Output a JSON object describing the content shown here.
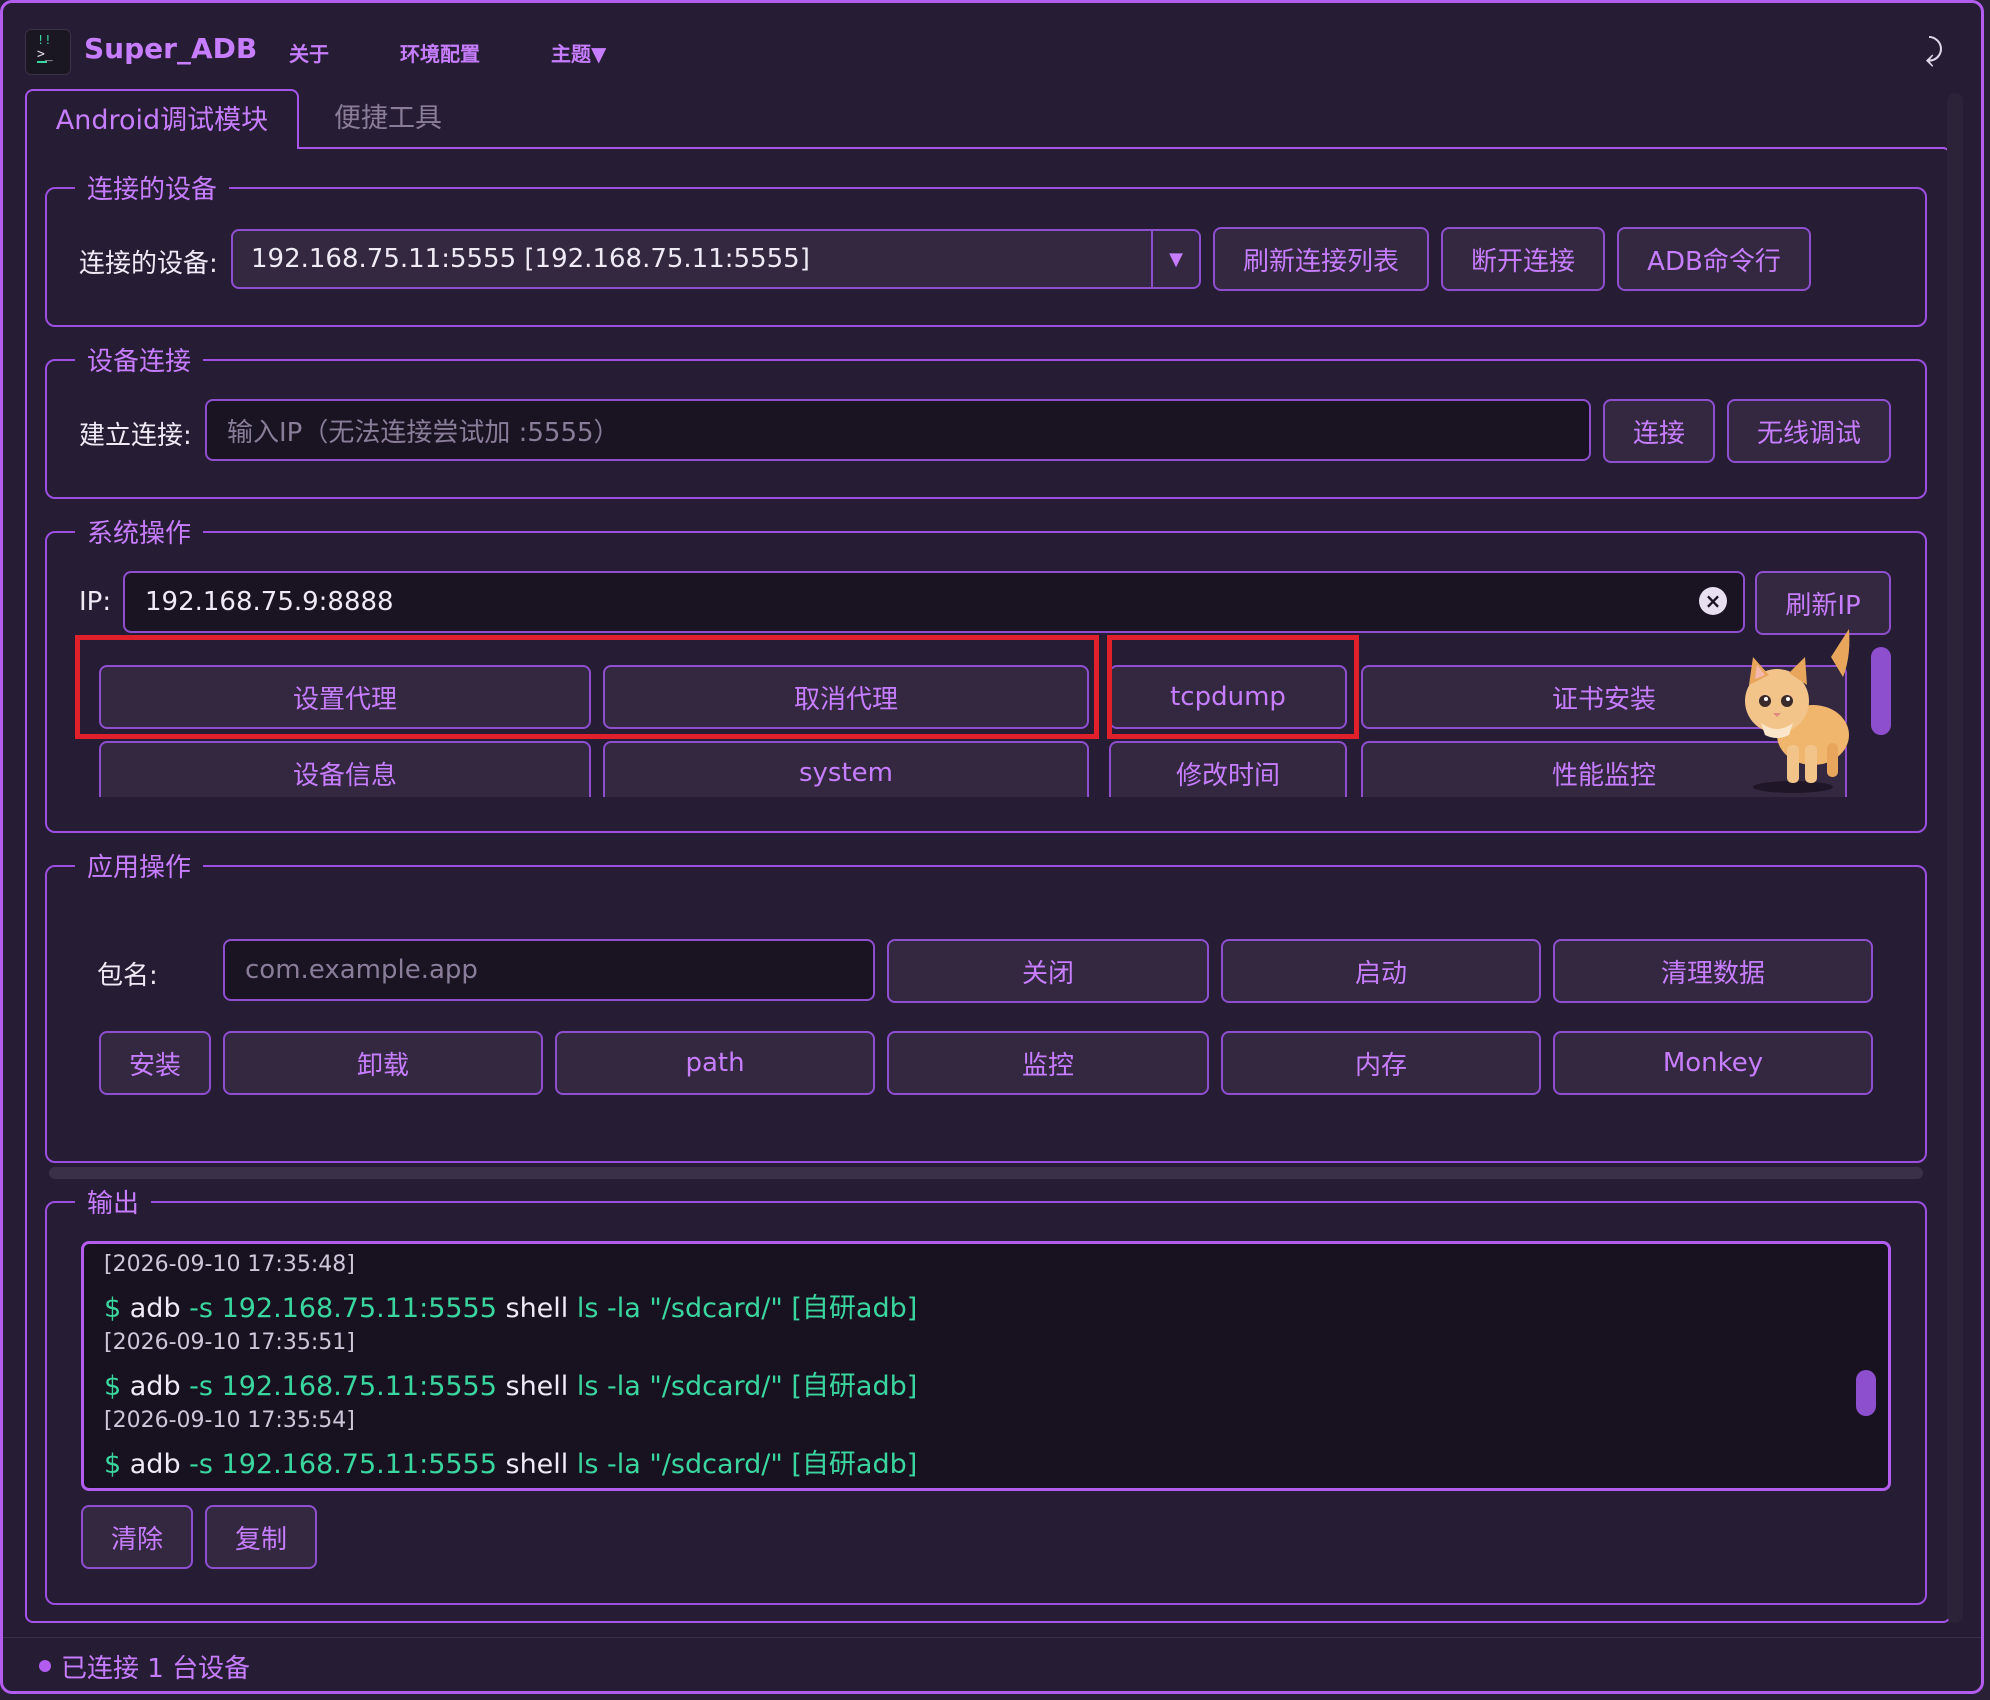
{
  "app": {
    "title": "Super_ADB",
    "menu": [
      "关于",
      "环境配置",
      "主题▼"
    ]
  },
  "tabs": [
    {
      "label": "Android调试模块",
      "active": true
    },
    {
      "label": "便捷工具",
      "active": false
    }
  ],
  "connected_devices": {
    "group_title": "连接的设备",
    "label": "连接的设备:",
    "selected": "192.168.75.11:5555  [192.168.75.11:5555]",
    "buttons": [
      "刷新连接列表",
      "断开连接",
      "ADB命令行"
    ]
  },
  "device_connect": {
    "group_title": "设备连接",
    "label": "建立连接:",
    "placeholder": "输入IP（无法连接尝试加 :5555）",
    "buttons": [
      "连接",
      "无线调试"
    ]
  },
  "system_ops": {
    "group_title": "系统操作",
    "ip_label": "IP:",
    "ip_value": "192.168.75.9:8888",
    "refresh_ip": "刷新IP",
    "row1": [
      "设置代理",
      "取消代理",
      "tcpdump",
      "证书安装"
    ],
    "row2": [
      "设备信息",
      "system",
      "修改时间",
      "性能监控"
    ]
  },
  "app_ops": {
    "group_title": "应用操作",
    "pkg_label": "包名:",
    "pkg_placeholder": "com.example.app",
    "row1": [
      "关闭",
      "启动",
      "清理数据"
    ],
    "row2": [
      "安装",
      "卸载",
      "path",
      "监控",
      "内存",
      "Monkey"
    ]
  },
  "output": {
    "group_title": "输出",
    "log": [
      {
        "ts": "[2026-09-10 17:35:48]",
        "cmd": [
          "$ ",
          "adb",
          " -s 192.168.75.11:5555 ",
          "shell",
          " ls -la \"/sdcard/\" [自研adb]"
        ]
      },
      {
        "ts": "[2026-09-10 17:35:51]",
        "cmd": [
          "$ ",
          "adb",
          " -s 192.168.75.11:5555 ",
          "shell",
          " ls -la \"/sdcard/\" [自研adb]"
        ]
      },
      {
        "ts": "[2026-09-10 17:35:54]",
        "cmd": [
          "$ ",
          "adb",
          " -s 192.168.75.11:5555 ",
          "shell",
          " ls -la \"/sdcard/\" [自研adb]"
        ]
      }
    ],
    "buttons": [
      "清除",
      "复制"
    ]
  },
  "status": "已连接 1 台设备",
  "colors": {
    "accent": "#c77dff",
    "border": "#b35cf0",
    "highlight": "#e0202a",
    "terminal_green": "#3ad6a0"
  }
}
